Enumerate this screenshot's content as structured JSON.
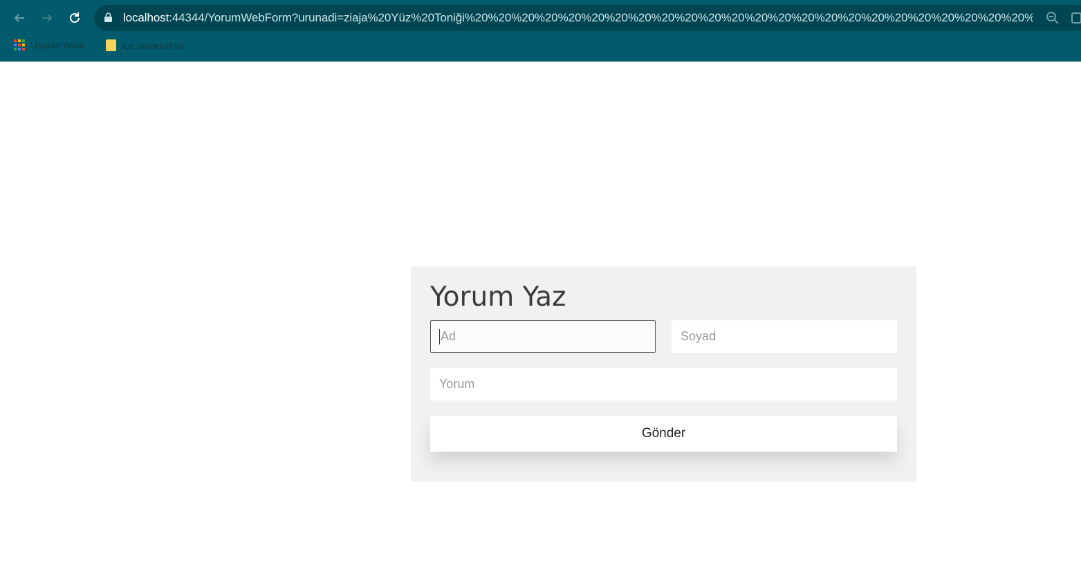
{
  "browser": {
    "url_host": "localhost",
    "url_rest": ":44344/YorumWebForm?urunadi=ziaja%20Yüz%20Toniği%20%20%20%20%20%20%20%20%20%20%20%20%20%20%20%20%20%20%20%20%20%20%20%20%20%20%20%20..."
  },
  "bookmarks": {
    "apps_label": "Uygulamalar",
    "folder_label": "İçe aktarılanlar"
  },
  "form": {
    "title": "Yorum Yaz",
    "first_name_placeholder": "Ad",
    "last_name_placeholder": "Soyad",
    "comment_placeholder": "Yorum",
    "submit_label": "Gönder"
  },
  "colors": {
    "browser_frame": "#015b6d",
    "panel_background": "#f1f1f1",
    "app_grid": [
      "#ea4335",
      "#fbbc04",
      "#34a853",
      "#4285f4",
      "#ea4335",
      "#fbbc04",
      "#34a853",
      "#4285f4",
      "#ea4335"
    ]
  },
  "icons": [
    "back-arrow-icon",
    "forward-arrow-icon",
    "reload-icon",
    "lock-icon",
    "zoom-icon",
    "extension-icon",
    "apps-icon",
    "folder-icon"
  ]
}
